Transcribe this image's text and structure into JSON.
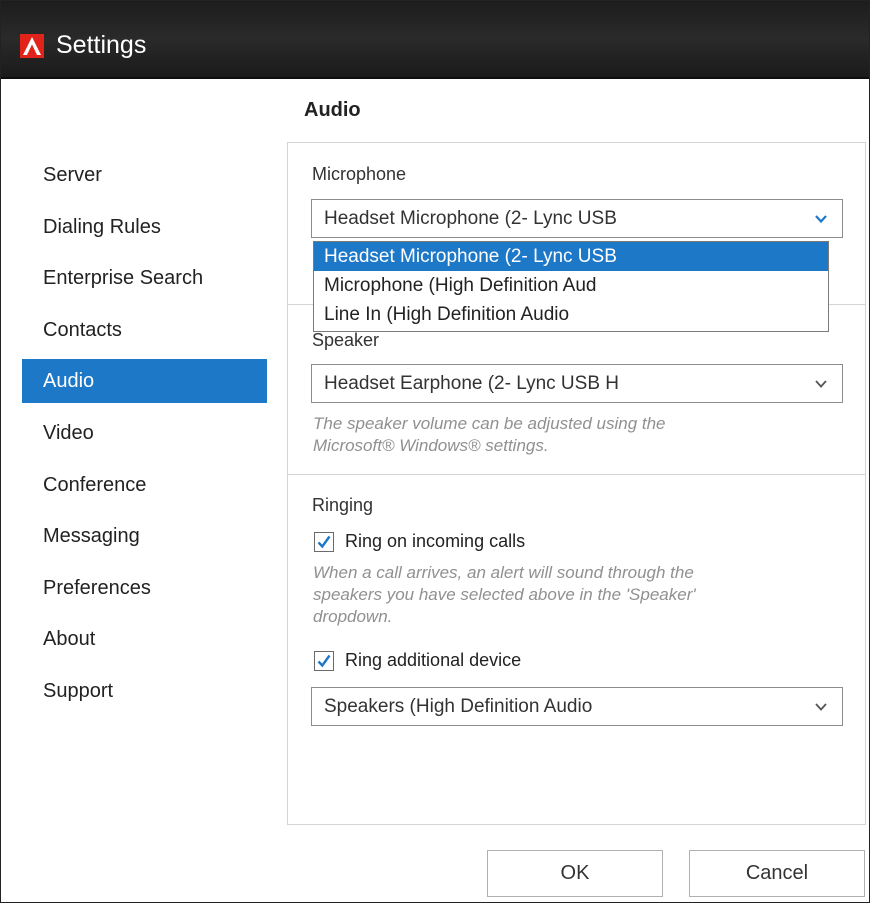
{
  "window": {
    "title": "Settings",
    "accent": "#e2231a"
  },
  "section": {
    "heading": "Audio"
  },
  "nav": {
    "items": [
      {
        "label": "Server"
      },
      {
        "label": "Dialing Rules"
      },
      {
        "label": "Enterprise Search"
      },
      {
        "label": "Contacts"
      },
      {
        "label": "Audio",
        "active": true
      },
      {
        "label": "Video"
      },
      {
        "label": "Conference"
      },
      {
        "label": "Messaging"
      },
      {
        "label": "Preferences"
      },
      {
        "label": "About"
      },
      {
        "label": "Support"
      }
    ],
    "active_color": "#1e78c8"
  },
  "microphone": {
    "label": "Microphone",
    "selected": "Headset Microphone (2- Lync USB",
    "options": [
      "Headset Microphone (2- Lync USB",
      "Microphone (High Definition Aud",
      "Line In (High Definition Audio"
    ]
  },
  "speaker": {
    "label": "Speaker",
    "selected": "Headset Earphone (2- Lync USB H",
    "helper": [
      "The speaker volume can be adjusted using the",
      "Microsoft® Windows® settings."
    ]
  },
  "ringing": {
    "label": "Ringing",
    "ring_incoming": {
      "label": "Ring on incoming calls",
      "checked": true
    },
    "helper": [
      "When a call arrives, an alert will sound through the",
      "speakers you have selected above in the 'Speaker'",
      "dropdown."
    ],
    "ring_additional": {
      "label": "Ring additional device",
      "checked": true
    },
    "additional_device": "Speakers (High Definition Audio"
  },
  "buttons": {
    "ok": "OK",
    "cancel": "Cancel"
  }
}
